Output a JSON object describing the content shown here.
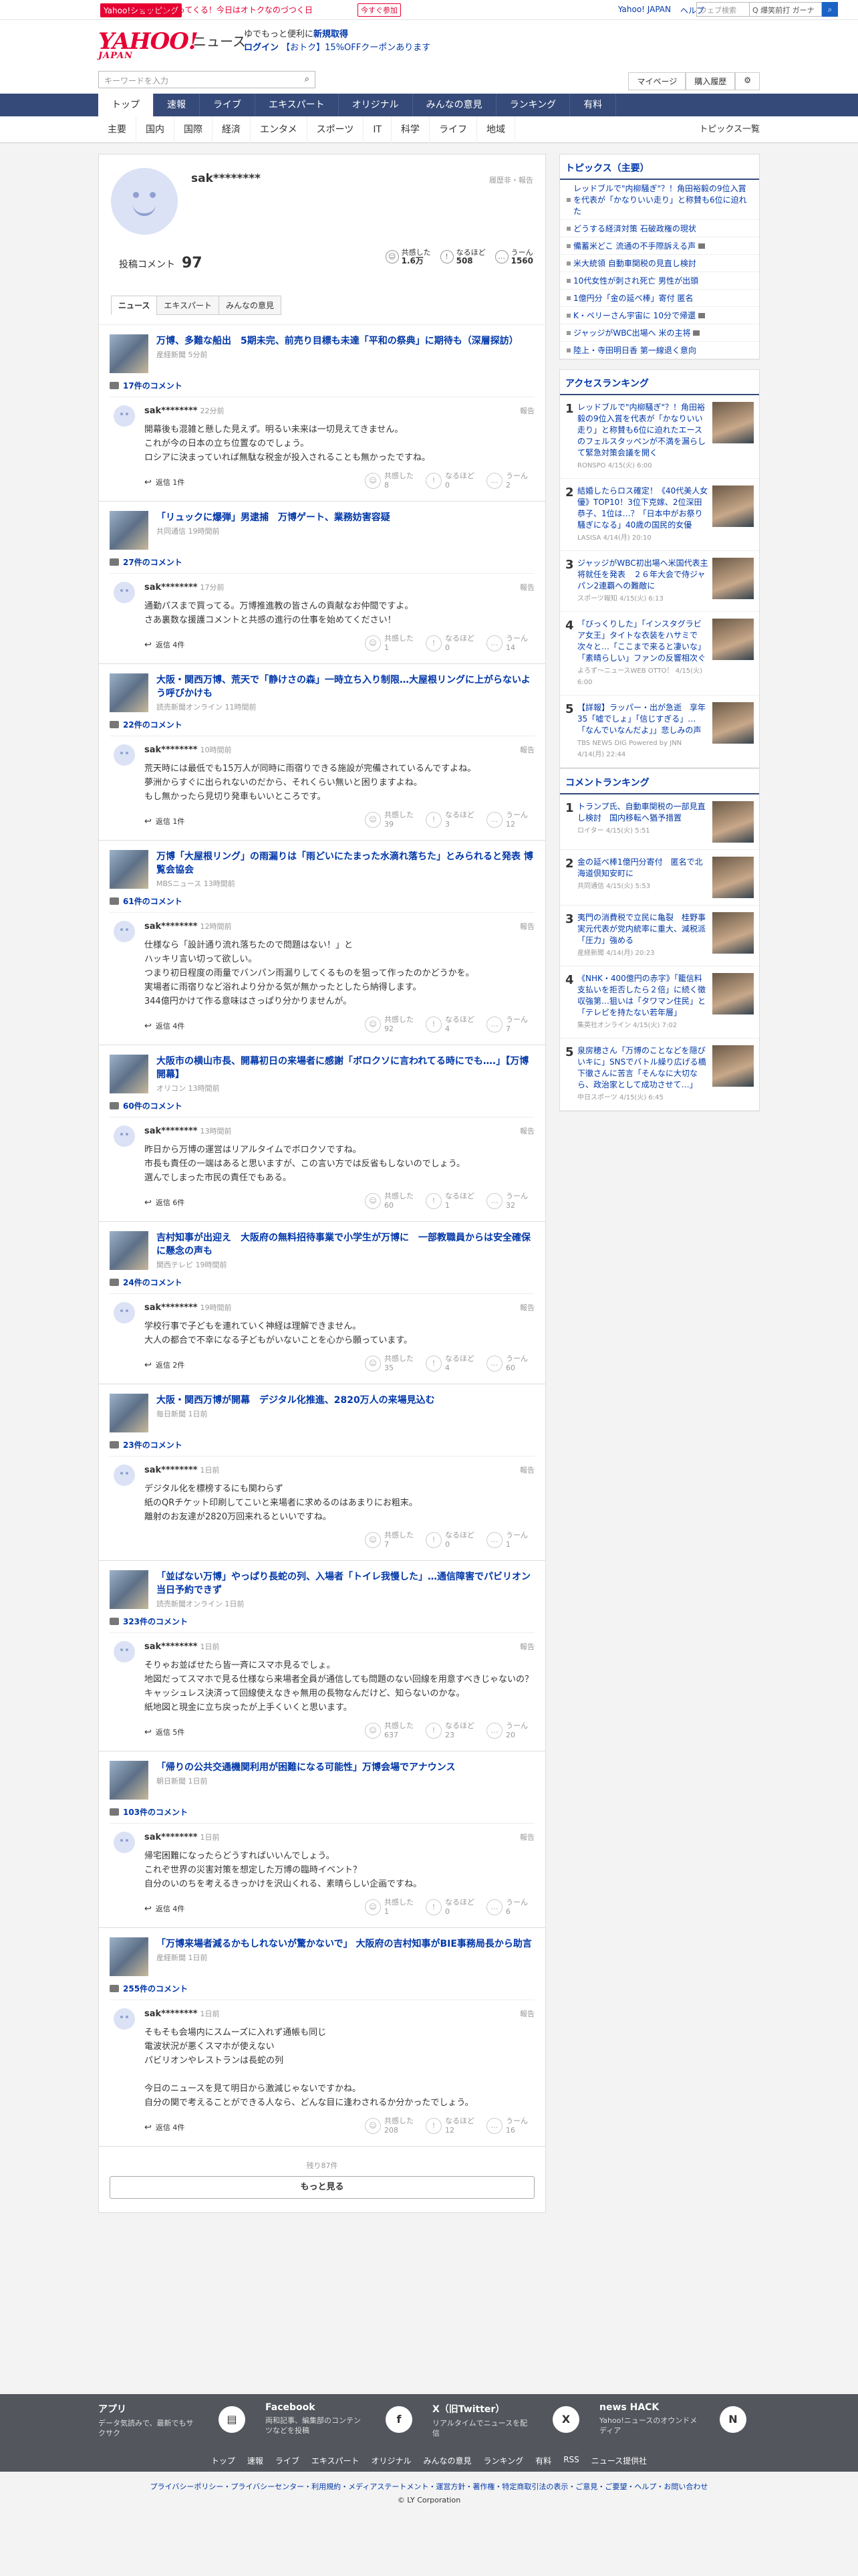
{
  "topbar": {
    "badge": "Yahoo!ショッピング",
    "promo": "5%相当戻ってくる！今日はオトクなのづつく日",
    "chip": "今すぐ参加",
    "links": [
      "Yahoo! JAPAN",
      "ヘルプ"
    ],
    "search_placeholder": "ウェブ検索",
    "search_value": "Q 爆笑前打 ガーナ"
  },
  "header": {
    "logo": "YAHOO!",
    "logo_sub": "JAPAN",
    "service": "ニュース",
    "ad_line1": "ゆでもっと便利に",
    "ad_highlight": "新規取得",
    "ad_line2": "ログイン",
    "ad_line2b": "【おトク】15%OFFクーポンあります"
  },
  "search": {
    "placeholder": "キーワードを入力",
    "mypage": "マイページ",
    "history": "購入履歴"
  },
  "gnav": [
    "トップ",
    "速報",
    "ライブ",
    "エキスパート",
    "オリジナル",
    "みんなの意見",
    "ランキング",
    "有料"
  ],
  "subnav": [
    "主要",
    "国内",
    "国際",
    "経済",
    "エンタメ",
    "スポーツ",
    "IT",
    "科学",
    "ライフ",
    "地域"
  ],
  "subnav_right": "トピックス一覧",
  "profile": {
    "name": "sak********",
    "history": "履歴非・報告",
    "count_label": "投稿コメント",
    "count": "97",
    "stats": [
      {
        "label": "共感した",
        "value": "1.6万"
      },
      {
        "label": "なるほど",
        "value": "508"
      },
      {
        "label": "うーん",
        "value": "1560"
      }
    ],
    "tabs": [
      "ニュース",
      "エキスパート",
      "みんなの意見"
    ]
  },
  "items": [
    {
      "title": "万博、多難な船出　5期未完、前売り目標も未達「平和の祭典」に期待も（深層探訪）",
      "source": "産経新聞 5分前",
      "ccount": "17件のコメント",
      "time": "22分前",
      "text": "開幕後も混雑と懸した見えず。明るい未来は一切見えてきません。\nこれが今の日本の立ち位置なのでしょう。\nロシアに決まっていれば無駄な税金が投入されることも無かったですね。",
      "reply": "返信 1件",
      "r": [
        "8",
        "0",
        "2"
      ]
    },
    {
      "title": "「リュックに爆弾」男逮捕　万博ゲート、業務妨害容疑",
      "source": "共同通信 19時間前",
      "ccount": "27件のコメント",
      "time": "17分前",
      "text": "通勤パスまで買ってる。万博推進教の皆さんの貢献なお仲間ですよ。\nさあ裏数な援護コメントと共感の進行の仕事を始めてください！",
      "reply": "返信 4件",
      "r": [
        "1",
        "0",
        "14"
      ]
    },
    {
      "title": "大阪・関西万博、荒天で「静けさの森」一時立ち入り制限…大屋根リングに上がらないよう呼びかけも",
      "source": "読売新聞オンライン 11時間前",
      "ccount": "22件のコメント",
      "time": "10時間前",
      "text": "荒天時には最低でも15万人が同時に雨宿りできる施設が完備されているんですよね。\n夢洲からすぐに出られないのだから、それくらい無いと困りますよね。\nもし無かったら見切り発車もいいところです。",
      "reply": "返信 1件",
      "r": [
        "39",
        "3",
        "12"
      ]
    },
    {
      "title": "万博「大屋根リング」の雨漏りは「雨どいにたまった水滴れ落ちた」とみられると発表 博覧会協会",
      "source": "MBSニュース 13時間前",
      "ccount": "61件のコメント",
      "time": "12時間前",
      "text": "仕様なら「設計通り流れ落ちたので問題はない！」と\nハッキリ言い切って欲しい。\nつまり初日程度の雨量でバンパン雨漏りしてくるものを狙って作ったのかどうかを。\n実場者に雨宿りなど浴れより分かる気が無かったとしたら納得します。\n344億円かけて作る意味はさっぱり分かりませんが。",
      "reply": "返信 4件",
      "r": [
        "92",
        "4",
        "7"
      ]
    },
    {
      "title": "大阪市の横山市長、開幕初日の来場者に感謝「ボロクソに言われてる時にでも….」【万博開幕】",
      "source": "オリコン 13時間前",
      "ccount": "60件のコメント",
      "time": "13時間前",
      "text": "昨日から万博の運営はリアルタイムでボロクソですね。\n市長も責任の一端はあると思いますが、この言い方では反省もしないのでしょう。\n選んでしまった市民の責任でもある。",
      "reply": "返信 6件",
      "r": [
        "60",
        "1",
        "32"
      ]
    },
    {
      "title": "吉村知事が出迎え　大阪府の無料招待事業で小学生が万博に　一部教職員からは安全確保に懸念の声も",
      "source": "関西テレビ 19時間前",
      "ccount": "24件のコメント",
      "time": "19時間前",
      "text": "学校行事で子どもを連れていく神経は理解できません。\n大人の都合で不幸になる子どもがいないことを心から願っています。",
      "reply": "返信 2件",
      "r": [
        "35",
        "4",
        "60"
      ]
    },
    {
      "title": "大阪・関西万博が開幕　デジタル化推進、2820万人の来場見込む",
      "source": "毎日新聞 1日前",
      "ccount": "23件のコメント",
      "time": "1日前",
      "text": "デジタル化を標榜するにも関わらず\n紙のQRチケット印刷してこいと来場者に求めるのはあまりにお粗末。\n離射のお友達が2820万回来れるといいですね。",
      "reply": "",
      "r": [
        "7",
        "0",
        "1"
      ]
    },
    {
      "title": "「並ばない万博」やっぱり長蛇の列、入場者「トイレ我慢した」…通信障害でパビリオン当日予約できず",
      "source": "読売新聞オンライン 1日前",
      "ccount": "323件のコメント",
      "time": "1日前",
      "text": "そりゃお並ばせたら皆一斉にスマホ見るでしょ。\n地図だってスマホで見る仕様なら来場者全員が通信しても問題のない回線を用意すべきじゃないの？\nキャッシュレス決済って回線使えなきゃ無用の長物なんだけど、知らないのかな。\n紙地図と現金に立ち戻ったが上手くいくと思います。",
      "reply": "返信 5件",
      "r": [
        "637",
        "23",
        "20"
      ]
    },
    {
      "title": "「帰りの公共交通機関利用が困難になる可能性」万博会場でアナウンス",
      "source": "朝日新聞 1日前",
      "ccount": "103件のコメント",
      "time": "1日前",
      "text": "帰宅困難になったらどうすればいいんでしょう。\nこれぞ世界の災害対策を想定した万博の臨時イベント？\n自分のいのちを考えるきっかけを沢山くれる、素晴らしい企画ですね。",
      "reply": "返信 4件",
      "r": [
        "1",
        "0",
        "6"
      ]
    },
    {
      "title": "「万博来場者減るかもしれないが驚かないで」 大阪府の吉村知事がBIE事務局長から助言",
      "source": "産経新聞 1日前",
      "ccount": "255件のコメント",
      "time": "1日前",
      "text": "そもそも会場内にスムーズに入れず通帳も同じ\n電波状況が悪くスマホが使えない\nパビリオンやレストランは長蛇の列\n\n今日のニュースを見て明日から激減じゃないですかね。\n自分の関で考えることができる人なら、どんな目に逢わされるか分かったでしょう。",
      "reply": "返信 4件",
      "r": [
        "208",
        "12",
        "16"
      ]
    }
  ],
  "more": {
    "remaining": "残り87件",
    "button": "もっと見る"
  },
  "topics": {
    "heading": "トピックス（主要）",
    "items": [
      "レッドブルで\"内柳騒ぎ\"？！角田裕毅の9位入賞を代表が「かなりいい走り」と称賛も6位に迫れた",
      "どうする経済対策 石破政権の現状",
      "備蓄米どこ 流通の不手際訴える声",
      "米大統領 自動車関税の見直し検討",
      "10代女性が刺され死亡 男性が出頭",
      "1億円分「金の延べ棒」寄付 匿名",
      "K・ペリーさん宇宙に 10分で帰還",
      "ジャッジがWBC出場へ 米の主将",
      "陸上・寺田明日香 第一線退く意向"
    ]
  },
  "access": {
    "heading": "アクセスランキング",
    "items": [
      {
        "text": "レッドブルで\"内柳騒ぎ\"？！角田裕毅の9位入賞を代表が「かなりいい走り」と称賛も6位に迫れたエースのフェルスタッペンが不満を漏らして緊急対策会議を開く",
        "src": "RONSPO 4/15(火) 6:00"
      },
      {
        "text": "結婚したらロス確定！《40代美人女優》TOP10！3位下克嫁、2位深田恭子、1位は…？「日本中がお祭り騒ぎになる」40歳の国民的女優",
        "src": "LASISA 4/14(月) 20:10"
      },
      {
        "text": "ジャッジがWBC初出場へ米国代表主将就任を発表　２６年大会で侍ジャパン2連覇への難敵に",
        "src": "スポーツ報知 4/15(火) 6:13"
      },
      {
        "text": "「びっくりした」「インスタグラビア女王」タイトな衣装をハサミで次々と…「ここまで来ると凄いな」「素晴らしい」ファンの反響相次ぐ",
        "src": "よろず〜ニュースWEB OTTO！ 4/15(火) 6:00"
      },
      {
        "text": "【詳報】ラッパー・出が急逝　享年35「嘘でしょ」「信じすぎる」…「なんでいなんだよ」」悲しみの声",
        "src": "TBS NEWS DIG Powered by JNN 4/14(月) 22:44"
      }
    ]
  },
  "commentrank": {
    "heading": "コメントランキング",
    "items": [
      {
        "text": "トランプ氏、自動車関税の一部見直し検討　国内移転へ猶予措置",
        "src": "ロイター 4/15(火) 5:51"
      },
      {
        "text": "金の延べ棒1億円分寄付　匿名で北海道倶知安町に",
        "src": "共同通信 4/15(火) 5:53"
      },
      {
        "text": "夷門の消費税で立民に亀裂　桂野事実元代表が党内統率に重大、減税派「圧力」強める",
        "src": "産経新聞 4/14(月) 20:23"
      },
      {
        "text": "《NHK・400億円の赤字》「籠信料支払いを拒否したら２倍」に続く徴収強第…狙いは「タワマン住民」と「テレビを持たない若年層」",
        "src": "集英社オンライン 4/15(火) 7:02"
      },
      {
        "text": "泉房穂さん「万博のことなどを隠ぴいキに」SNSでバトル繰り広げる橋下徹さんに苦言「そんなに大切なら、政治家として成功させて…」",
        "src": "中日スポーツ 4/15(火) 6:45"
      }
    ]
  },
  "footer": {
    "apps": [
      {
        "title": "アプリ",
        "desc": "データ気読みで、最新でもサクサク",
        "icon": "▤"
      },
      {
        "title": "Facebook",
        "desc": "両和記事、編集部のコンテンツなどを投稿",
        "icon": "f"
      },
      {
        "title": "X（旧Twitter）",
        "desc": "リアルタイムでニュースを配信",
        "icon": "X"
      },
      {
        "title": "news HACK",
        "desc": "Yahoo!ニュースのオウンドメディア",
        "icon": "N"
      }
    ],
    "links": [
      "トップ",
      "速報",
      "ライブ",
      "エキスパート",
      "オリジナル",
      "みんなの意見",
      "ランキング",
      "有料",
      "RSS",
      "ニュース提供社"
    ],
    "bottom": "プライバシーポリシー・プライバシーセンター・利用規約・メディアステートメント・運営方針・著作権・特定商取引法の表示・ご意見・ご要望・ヘルプ・お問い合わせ",
    "copy": "© LY Corporation"
  }
}
